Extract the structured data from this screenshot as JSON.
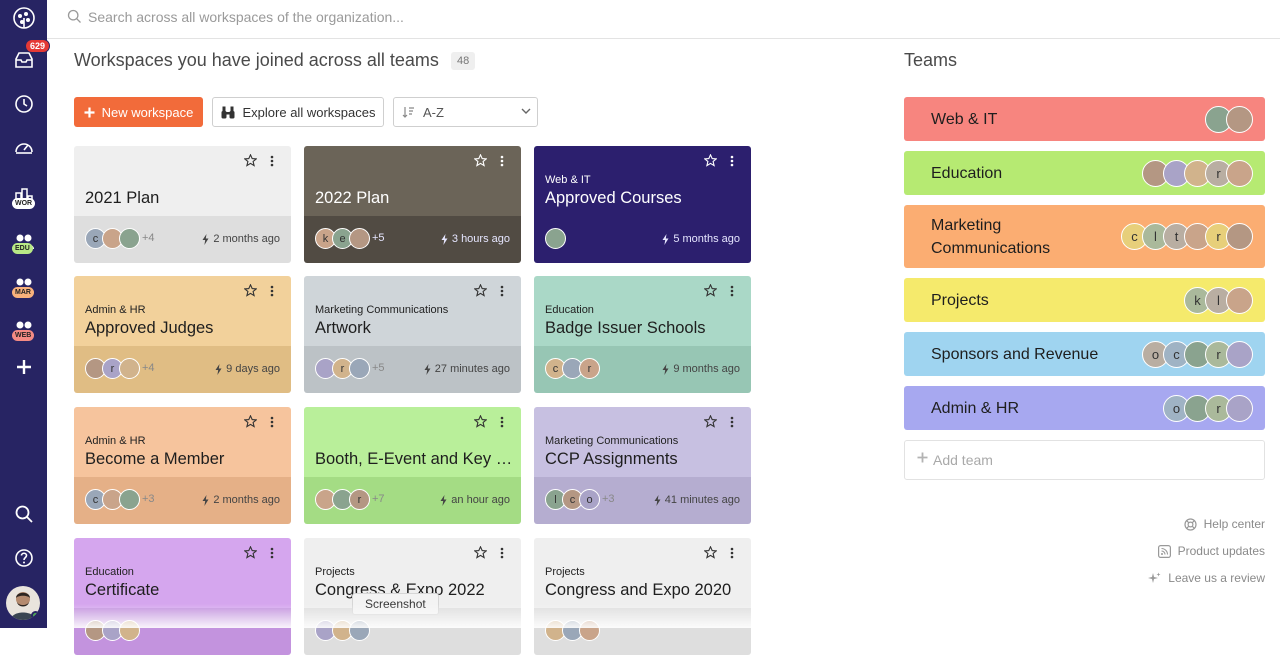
{
  "search": {
    "placeholder": "Search across all workspaces of the organization..."
  },
  "sidebar": {
    "notifications_count": "629",
    "team_tags": [
      {
        "label": "WOR",
        "color": "#ffffff"
      },
      {
        "label": "EDU",
        "color": "#b8e986"
      },
      {
        "label": "MAR",
        "color": "#f9b27c"
      },
      {
        "label": "WEB",
        "color": "#f48b84"
      }
    ],
    "icons": [
      "logo-icon",
      "inbox-icon",
      "clock-icon",
      "dashboard-icon",
      "workspaces-icon",
      "team-icon",
      "plus-icon",
      "search-icon",
      "help-icon"
    ]
  },
  "main": {
    "title": "Workspaces you have joined across all teams",
    "count": "48",
    "new_button": "New workspace",
    "explore_button": "Explore all workspaces",
    "sort": {
      "value": "A-Z"
    }
  },
  "workspaces": [
    {
      "team": "",
      "name": "2021 Plan",
      "avatars": [
        "c",
        "",
        ""
      ],
      "extra": "+4",
      "time": "2 months ago",
      "top": "#efefef",
      "bottom": "#dedede",
      "dark": false
    },
    {
      "team": "",
      "name": "2022 Plan",
      "avatars": [
        "k",
        "e",
        ""
      ],
      "extra": "+5",
      "time": "3 hours ago",
      "top": "#6b6458",
      "bottom": "#514b43",
      "dark": true
    },
    {
      "team": "Web & IT",
      "name": "Approved Courses",
      "avatars": [
        ""
      ],
      "extra": "",
      "time": "5 months ago",
      "top": "#2c1f6e",
      "bottom": "#2c1f6e",
      "dark": true
    },
    {
      "team": "Admin & HR",
      "name": "Approved Judges",
      "avatars": [
        "",
        "r",
        ""
      ],
      "extra": "+4",
      "time": "9 days ago",
      "top": "#f2d19b",
      "bottom": "#e0bd84",
      "dark": false
    },
    {
      "team": "Marketing Communications",
      "name": "Artwork",
      "avatars": [
        "",
        "r",
        ""
      ],
      "extra": "+5",
      "time": "27 minutes ago",
      "top": "#cfd5d9",
      "bottom": "#bcc2c6",
      "dark": false
    },
    {
      "team": "Education",
      "name": "Badge Issuer Schools",
      "avatars": [
        "c",
        "",
        "r"
      ],
      "extra": "",
      "time": "9 months ago",
      "top": "#aad8c7",
      "bottom": "#97c6b4",
      "dark": false
    },
    {
      "team": "Admin & HR",
      "name": "Become a Member",
      "avatars": [
        "c",
        "",
        ""
      ],
      "extra": "+3",
      "time": "2 months ago",
      "top": "#f6c49d",
      "bottom": "#e5b087",
      "dark": false
    },
    {
      "team": "",
      "name": "Booth, E-Event and Key C...",
      "avatars": [
        "",
        "",
        "r"
      ],
      "extra": "+7",
      "time": "an hour ago",
      "top": "#b9ef9a",
      "bottom": "#a4dc84",
      "dark": false
    },
    {
      "team": "Marketing Communications",
      "name": "CCP Assignments",
      "avatars": [
        "l",
        "c",
        "o"
      ],
      "extra": "+3",
      "time": "41 minutes ago",
      "top": "#c7c0e1",
      "bottom": "#b5add0",
      "dark": false
    },
    {
      "team": "Education",
      "name": "Certificate",
      "avatars": [
        "",
        "",
        ""
      ],
      "extra": "",
      "time": "",
      "top": "#d5a6ee",
      "bottom": "#c393de",
      "dark": false
    },
    {
      "team": "Projects",
      "name": "Congress & Expo 2022",
      "avatars": [
        "",
        "",
        ""
      ],
      "extra": "",
      "time": "",
      "top": "#efefef",
      "bottom": "#dedede",
      "dark": false
    },
    {
      "team": "Projects",
      "name": "Congress and Expo 2020",
      "avatars": [
        "",
        "",
        ""
      ],
      "extra": "",
      "time": "",
      "top": "#efefef",
      "bottom": "#dedede",
      "dark": false
    }
  ],
  "teams": {
    "title": "Teams",
    "items": [
      {
        "name": "Web & IT",
        "color": "#f7857f",
        "avatars": [
          "",
          ""
        ]
      },
      {
        "name": "Education",
        "color": "#b6ea72",
        "avatars": [
          "",
          "",
          "",
          "r",
          ""
        ]
      },
      {
        "name": "Marketing Communications",
        "color": "#fbad72",
        "avatars": [
          "c",
          "l",
          "t",
          "",
          "r",
          ""
        ]
      },
      {
        "name": "Projects",
        "color": "#f5ea6c",
        "avatars": [
          "k",
          "l",
          ""
        ]
      },
      {
        "name": "Sponsors and Revenue",
        "color": "#9fd4f0",
        "avatars": [
          "o",
          "c",
          "",
          "r",
          ""
        ]
      },
      {
        "name": "Admin & HR",
        "color": "#a7a8f0",
        "avatars": [
          "o",
          "",
          "r",
          ""
        ]
      }
    ],
    "add_placeholder": "Add team"
  },
  "help": {
    "help_center": "Help center",
    "product_updates": "Product updates",
    "review": "Leave us a review"
  },
  "tooltip": "Screenshot",
  "colors": {
    "sidebar": "#272463",
    "accent": "#f26b3a"
  }
}
